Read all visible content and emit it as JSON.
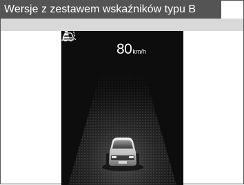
{
  "header": {
    "title": "Wersje z zestawem wskaźników typu B"
  },
  "display": {
    "speed_value": "80",
    "speed_unit": "km/h",
    "icons": [
      "lane-keeping-icon",
      "road-departure-icon"
    ],
    "colors": {
      "background": "#0d0d0d",
      "text": "#ffffff",
      "header_bg": "#545454",
      "band_bg": "#d9d9d9"
    }
  }
}
